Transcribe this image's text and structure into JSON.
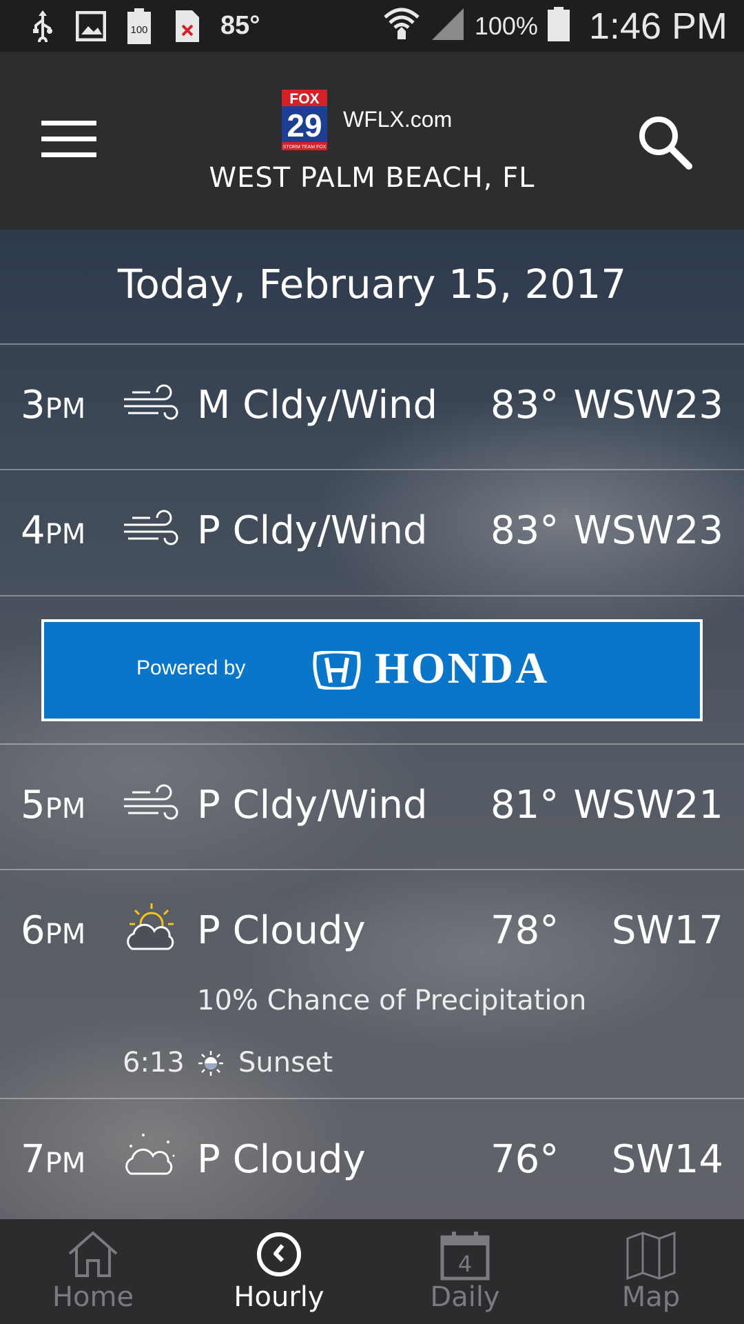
{
  "status_bar": {
    "temperature": "85°",
    "battery_icon_label": "100",
    "battery_percent": "100%",
    "time": "1:46 PM"
  },
  "header": {
    "logo": {
      "line1": "FOX",
      "line2": "29",
      "line3": "STORM TEAM FOX"
    },
    "brand": "WFLX.com",
    "location": "WEST PALM BEACH, FL"
  },
  "date_heading": "Today, February 15, 2017",
  "hourly": [
    {
      "hour": "3",
      "ampm": "PM",
      "icon": "wind-icon",
      "condition": "M Cldy/Wind",
      "temp": "83°",
      "wind": "WSW23"
    },
    {
      "hour": "4",
      "ampm": "PM",
      "icon": "wind-icon",
      "condition": "P Cldy/Wind",
      "temp": "83°",
      "wind": "WSW23"
    },
    {
      "hour": "5",
      "ampm": "PM",
      "icon": "wind-icon",
      "condition": "P Cldy/Wind",
      "temp": "81°",
      "wind": "WSW21"
    },
    {
      "hour": "6",
      "ampm": "PM",
      "icon": "partly-cloudy-day-icon",
      "condition": "P Cloudy",
      "temp": "78°",
      "wind": "SW17",
      "precip": "10% Chance of Precipitation",
      "sun_event_time": "6:13",
      "sun_event": "Sunset"
    },
    {
      "hour": "7",
      "ampm": "PM",
      "icon": "partly-cloudy-night-icon",
      "condition": "P Cloudy",
      "temp": "76°",
      "wind": "SW14"
    }
  ],
  "ad": {
    "prefix": "Powered by",
    "brand": "HONDA"
  },
  "bottom_nav": {
    "items": [
      {
        "label": "Home",
        "icon": "home-icon",
        "active": false
      },
      {
        "label": "Hourly",
        "icon": "clock-icon",
        "active": true
      },
      {
        "label": "Daily",
        "icon": "calendar-icon",
        "active": false,
        "badge": "4"
      },
      {
        "label": "Map",
        "icon": "map-icon",
        "active": false
      }
    ]
  },
  "colors": {
    "header_bg": "#2c2d2f",
    "nav_bg": "#2b2c2e",
    "ad_bg": "#0a76c9",
    "fox_red": "#d62027",
    "fox_blue": "#1c3f94",
    "sun_yellow": "#f5c518"
  }
}
